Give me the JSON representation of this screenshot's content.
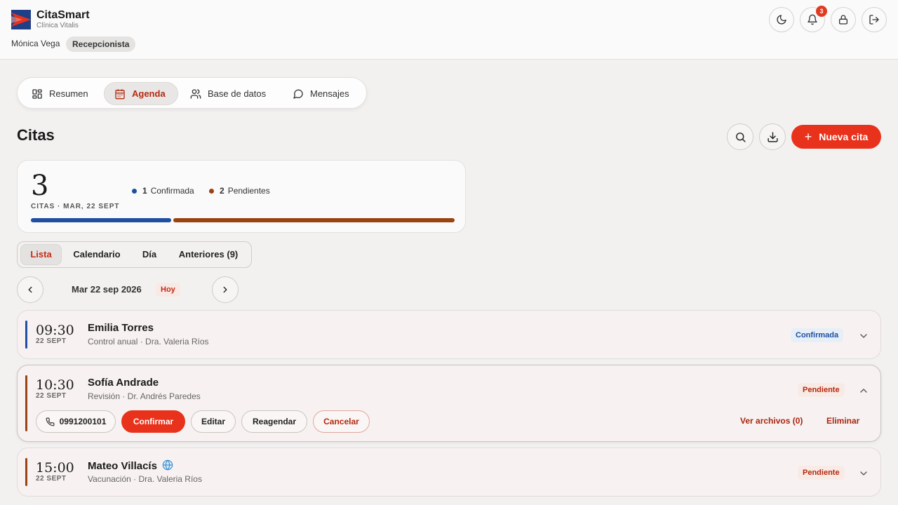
{
  "header": {
    "brand_name": "CitaSmart",
    "brand_sub": "Clínica Vitalis",
    "user_name": "Mónica Vega",
    "role": "Recepcionista",
    "notifications_count": "3",
    "icons": [
      "moon-icon",
      "bell-icon",
      "lock-icon",
      "logout-icon"
    ]
  },
  "nav": {
    "items": [
      {
        "label": "Resumen",
        "icon": "grid-icon"
      },
      {
        "label": "Agenda",
        "icon": "calendar-icon",
        "active": true
      },
      {
        "label": "Base de datos",
        "icon": "users-icon"
      },
      {
        "label": "Mensajes",
        "icon": "chat-icon"
      }
    ]
  },
  "page": {
    "title": "Citas",
    "new_button": "Nueva cita",
    "icons": [
      "search-icon",
      "download-icon",
      "plus-icon"
    ]
  },
  "summary": {
    "count": "3",
    "subtitle": "CITAS · MAR, 22 SEPT",
    "confirmed_count": "1",
    "confirmed_label": "Confirmada",
    "pending_count": "2",
    "pending_label": "Pendientes",
    "confirmed_color": "#1f4fa0",
    "pending_color": "#9a4312",
    "confirmed_fraction": 0.333,
    "pending_fraction": 0.667
  },
  "view_tabs": [
    {
      "label": "Lista",
      "active": true
    },
    {
      "label": "Calendario"
    },
    {
      "label": "Día"
    },
    {
      "label": "Anteriores (9)"
    }
  ],
  "date_nav": {
    "label": "Mar 22 sep 2026",
    "today": "Hoy"
  },
  "appointments": [
    {
      "time": "09:30",
      "date": "22 SEPT",
      "name": "Emilia Torres",
      "desc": "Control anual · Dra. Valeria Ríos",
      "status": "Confirmada",
      "accent": "#1f4fa0",
      "expanded": false
    },
    {
      "time": "10:30",
      "date": "22 SEPT",
      "name": "Sofía Andrade",
      "desc": "Revisión · Dr. Andrés Paredes",
      "status": "Pendiente",
      "accent": "#9a4312",
      "expanded": true,
      "phone": "0991200101",
      "actions": {
        "confirm": "Confirmar",
        "edit": "Editar",
        "reschedule": "Reagendar",
        "cancel": "Cancelar",
        "files": "Ver archivos (0)",
        "delete": "Eliminar"
      }
    },
    {
      "time": "15:00",
      "date": "22 SEPT",
      "name": "Mateo Villacís",
      "desc": "Vacunación · Dra. Valeria Ríos",
      "status": "Pendiente",
      "accent": "#9a4312",
      "expanded": false,
      "online_icon": "globe-icon"
    }
  ]
}
